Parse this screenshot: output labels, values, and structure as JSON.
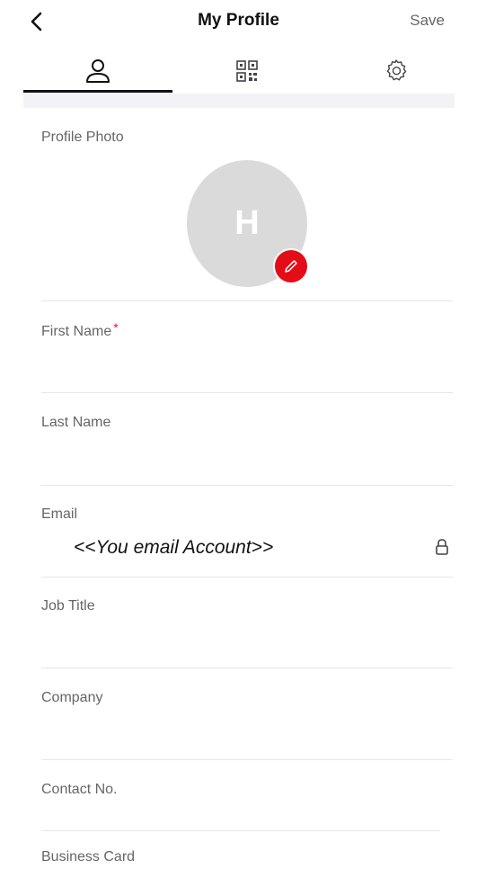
{
  "header": {
    "title": "My Profile",
    "save_label": "Save",
    "back_icon": "chevron-left-icon"
  },
  "tabs": [
    {
      "id": "profile",
      "icon": "user-icon",
      "active": true
    },
    {
      "id": "qr",
      "icon": "qr-code-icon",
      "active": false
    },
    {
      "id": "settings",
      "icon": "gear-icon",
      "active": false
    }
  ],
  "profile_photo": {
    "label": "Profile Photo",
    "initial": "H",
    "edit_icon": "pencil-icon"
  },
  "form": {
    "first_name": {
      "label": "First Name",
      "required_mark": "*",
      "value": ""
    },
    "last_name": {
      "label": "Last Name",
      "value": ""
    },
    "email": {
      "label": "Email",
      "value": "<<You email Account>>",
      "icon": "lock-icon"
    },
    "job_title": {
      "label": "Job Title",
      "value": ""
    },
    "company": {
      "label": "Company",
      "value": ""
    },
    "contact_no": {
      "label": "Contact No.",
      "value": ""
    },
    "business_card": {
      "label": "Business Card"
    }
  },
  "colors": {
    "accent": "#e30d17",
    "avatar_bg": "#dadada",
    "tab_strip": "#f2f3f7"
  }
}
